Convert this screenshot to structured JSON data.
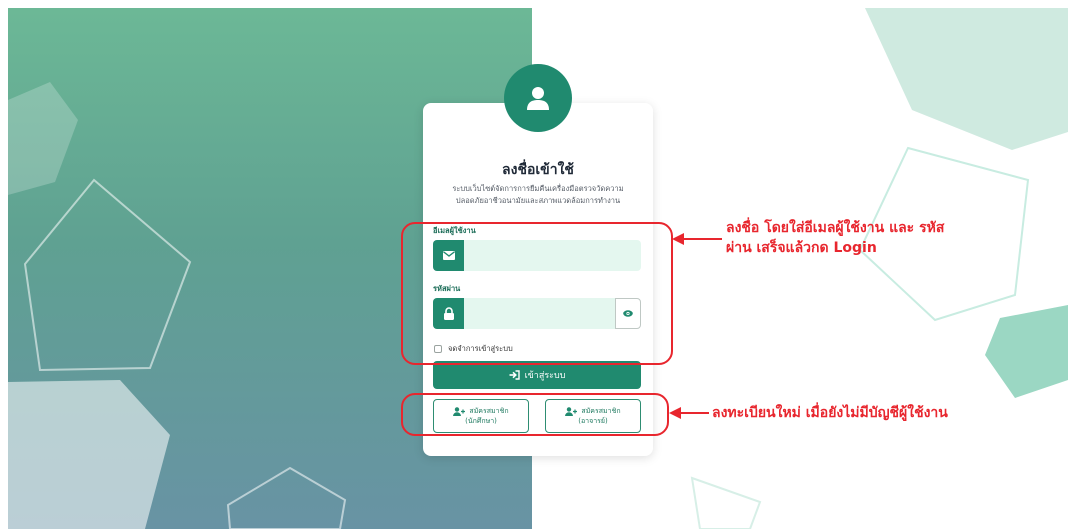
{
  "login": {
    "title": "ลงชื่อเข้าใช้",
    "subtitle_line1": "ระบบเว็บไซต์จัดการการยืมคืนเครื่องมือตรวจวัดความ",
    "subtitle_line2": "ปลอดภัยอาชีวอนามัยและสภาพแวดล้อมการทำงาน",
    "email_label": "อีเมลผู้ใช้งาน",
    "email_value": "",
    "password_label": "รหัสผ่าน",
    "password_value": "",
    "remember_label": "จดจำการเข้าสู่ระบบ",
    "remember_checked": false,
    "login_button": "เข้าสู่ระบบ",
    "register_student_line1": "สมัครสมาชิก",
    "register_student_line2": "(นักศึกษา)",
    "register_teacher_line1": "สมัครสมาชิก",
    "register_teacher_line2": "(อาจารย์)"
  },
  "annotations": {
    "login_note_line1": "ลงชื่อ โดยใส่อีเมลผู้ใช้งาน และ รหัส",
    "login_note_line2": "ผ่าน เสร็จแล้วกด Login",
    "register_note": "ลงทะเบียนใหม่ เมื่อยังไม่มีบัญชีผู้ใช้งาน"
  },
  "icons": {
    "avatar": "user-icon",
    "email": "envelope-icon",
    "password": "lock-icon",
    "show_password": "eye-icon",
    "login": "sign-in-icon",
    "register": "user-plus-icon"
  },
  "colors": {
    "primary": "#208a6f",
    "input_bg": "#e4f7ef",
    "annotation": "#e8262e"
  }
}
